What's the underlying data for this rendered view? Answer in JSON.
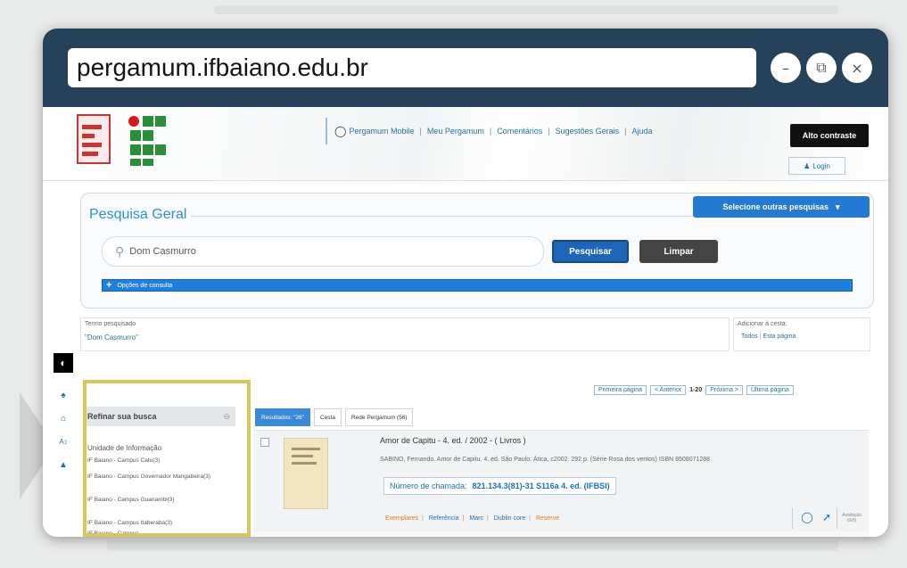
{
  "browser": {
    "url": "pergamum.ifbaiano.edu.br",
    "buttons": {
      "minimize": "–",
      "restore": "⧉",
      "close": "×"
    }
  },
  "header": {
    "nav": [
      "Pergamum Mobile",
      "Meu Pergamum",
      "Comentários",
      "Sugestões Gerais",
      "Ajuda"
    ],
    "contrast_button": "Alto contraste",
    "login_button": "Login"
  },
  "search": {
    "section_title": "Pesquisa Geral",
    "select_button": "Selecione outras pesquisas",
    "query": "Dom Casmurro",
    "search_button": "Pesquisar",
    "clear_button": "Limpar",
    "options_label": "Opções de consulta"
  },
  "summary": {
    "term_label": "Termo pesquisado",
    "term_value": "\"Dom Casmurro\"",
    "basket_label": "Adicionar à cesta:",
    "basket_all": "Todos",
    "basket_page": "Esta página"
  },
  "pagination": {
    "first": "Primeira página",
    "prev": "< Anterior",
    "range": "1-20",
    "next": "Próxima >",
    "last": "Última página"
  },
  "refine": {
    "title": "Refinar sua busca",
    "group_title": "Unidade de Informação",
    "items": [
      "IF Baiano - Campus Catu(3)",
      "IF Baiano - Campus Governador Mangabeira(3)",
      "IF Baiano - Campus Guanambi(3)",
      "IF Baiano - Campus Itaberaba(3)",
      "IF Baiano - Campus"
    ]
  },
  "tabs": [
    "Resultados: \"26\"",
    "Cesta",
    "Rede Pergamum (56)"
  ],
  "result": {
    "title": "Amor de Capitu - 4. ed. / 2002 - ( Livros )",
    "description": "SABINO, Fernando. Amor de Capitu. 4. ed. São Paulo: Ática, c2002. 292 p. (Série Rosa dos ventos) ISBN 8508071288",
    "call_label": "Número de chamada:",
    "call_value": "821.134.3(81)-31 S116a 4. ed. (IFBSI)",
    "links": [
      "Exemplares",
      "Referência",
      "Marc",
      "Dublin core",
      "Reserve"
    ],
    "rating_label": "Avaliação",
    "rating_value": "(0/0)"
  },
  "colors": {
    "titlebar": "#26425a",
    "accent": "#2479d2",
    "highlight": "#d8c65a"
  }
}
